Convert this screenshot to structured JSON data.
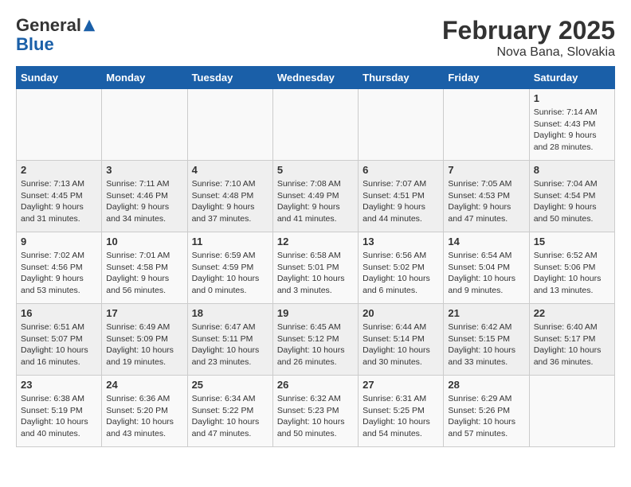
{
  "header": {
    "logo_general": "General",
    "logo_blue": "Blue",
    "month_year": "February 2025",
    "location": "Nova Bana, Slovakia"
  },
  "days_of_week": [
    "Sunday",
    "Monday",
    "Tuesday",
    "Wednesday",
    "Thursday",
    "Friday",
    "Saturday"
  ],
  "weeks": [
    [
      {
        "day": "",
        "detail": ""
      },
      {
        "day": "",
        "detail": ""
      },
      {
        "day": "",
        "detail": ""
      },
      {
        "day": "",
        "detail": ""
      },
      {
        "day": "",
        "detail": ""
      },
      {
        "day": "",
        "detail": ""
      },
      {
        "day": "1",
        "detail": "Sunrise: 7:14 AM\nSunset: 4:43 PM\nDaylight: 9 hours and 28 minutes."
      }
    ],
    [
      {
        "day": "2",
        "detail": "Sunrise: 7:13 AM\nSunset: 4:45 PM\nDaylight: 9 hours and 31 minutes."
      },
      {
        "day": "3",
        "detail": "Sunrise: 7:11 AM\nSunset: 4:46 PM\nDaylight: 9 hours and 34 minutes."
      },
      {
        "day": "4",
        "detail": "Sunrise: 7:10 AM\nSunset: 4:48 PM\nDaylight: 9 hours and 37 minutes."
      },
      {
        "day": "5",
        "detail": "Sunrise: 7:08 AM\nSunset: 4:49 PM\nDaylight: 9 hours and 41 minutes."
      },
      {
        "day": "6",
        "detail": "Sunrise: 7:07 AM\nSunset: 4:51 PM\nDaylight: 9 hours and 44 minutes."
      },
      {
        "day": "7",
        "detail": "Sunrise: 7:05 AM\nSunset: 4:53 PM\nDaylight: 9 hours and 47 minutes."
      },
      {
        "day": "8",
        "detail": "Sunrise: 7:04 AM\nSunset: 4:54 PM\nDaylight: 9 hours and 50 minutes."
      }
    ],
    [
      {
        "day": "9",
        "detail": "Sunrise: 7:02 AM\nSunset: 4:56 PM\nDaylight: 9 hours and 53 minutes."
      },
      {
        "day": "10",
        "detail": "Sunrise: 7:01 AM\nSunset: 4:58 PM\nDaylight: 9 hours and 56 minutes."
      },
      {
        "day": "11",
        "detail": "Sunrise: 6:59 AM\nSunset: 4:59 PM\nDaylight: 10 hours and 0 minutes."
      },
      {
        "day": "12",
        "detail": "Sunrise: 6:58 AM\nSunset: 5:01 PM\nDaylight: 10 hours and 3 minutes."
      },
      {
        "day": "13",
        "detail": "Sunrise: 6:56 AM\nSunset: 5:02 PM\nDaylight: 10 hours and 6 minutes."
      },
      {
        "day": "14",
        "detail": "Sunrise: 6:54 AM\nSunset: 5:04 PM\nDaylight: 10 hours and 9 minutes."
      },
      {
        "day": "15",
        "detail": "Sunrise: 6:52 AM\nSunset: 5:06 PM\nDaylight: 10 hours and 13 minutes."
      }
    ],
    [
      {
        "day": "16",
        "detail": "Sunrise: 6:51 AM\nSunset: 5:07 PM\nDaylight: 10 hours and 16 minutes."
      },
      {
        "day": "17",
        "detail": "Sunrise: 6:49 AM\nSunset: 5:09 PM\nDaylight: 10 hours and 19 minutes."
      },
      {
        "day": "18",
        "detail": "Sunrise: 6:47 AM\nSunset: 5:11 PM\nDaylight: 10 hours and 23 minutes."
      },
      {
        "day": "19",
        "detail": "Sunrise: 6:45 AM\nSunset: 5:12 PM\nDaylight: 10 hours and 26 minutes."
      },
      {
        "day": "20",
        "detail": "Sunrise: 6:44 AM\nSunset: 5:14 PM\nDaylight: 10 hours and 30 minutes."
      },
      {
        "day": "21",
        "detail": "Sunrise: 6:42 AM\nSunset: 5:15 PM\nDaylight: 10 hours and 33 minutes."
      },
      {
        "day": "22",
        "detail": "Sunrise: 6:40 AM\nSunset: 5:17 PM\nDaylight: 10 hours and 36 minutes."
      }
    ],
    [
      {
        "day": "23",
        "detail": "Sunrise: 6:38 AM\nSunset: 5:19 PM\nDaylight: 10 hours and 40 minutes."
      },
      {
        "day": "24",
        "detail": "Sunrise: 6:36 AM\nSunset: 5:20 PM\nDaylight: 10 hours and 43 minutes."
      },
      {
        "day": "25",
        "detail": "Sunrise: 6:34 AM\nSunset: 5:22 PM\nDaylight: 10 hours and 47 minutes."
      },
      {
        "day": "26",
        "detail": "Sunrise: 6:32 AM\nSunset: 5:23 PM\nDaylight: 10 hours and 50 minutes."
      },
      {
        "day": "27",
        "detail": "Sunrise: 6:31 AM\nSunset: 5:25 PM\nDaylight: 10 hours and 54 minutes."
      },
      {
        "day": "28",
        "detail": "Sunrise: 6:29 AM\nSunset: 5:26 PM\nDaylight: 10 hours and 57 minutes."
      },
      {
        "day": "",
        "detail": ""
      }
    ]
  ]
}
